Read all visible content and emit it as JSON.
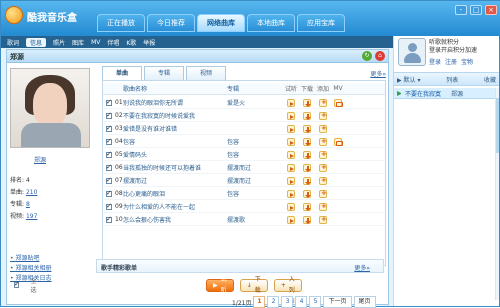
{
  "app": {
    "title": "酷我音乐盒",
    "controls": [
      "-",
      "□",
      "×"
    ]
  },
  "main_tabs": [
    {
      "label": "正在播放",
      "active": false
    },
    {
      "label": "今日推荐",
      "active": false
    },
    {
      "label": "网络曲库",
      "active": true
    },
    {
      "label": "本地曲库",
      "active": false
    },
    {
      "label": "应用宝库",
      "active": false
    }
  ],
  "subnav": [
    "歌词",
    "信息",
    "照片",
    "图库",
    "MV",
    "伴唱",
    "K歌",
    "举报"
  ],
  "artist": {
    "name": "郑源",
    "caption": "郑源",
    "meta": [
      {
        "label": "排名:",
        "value": "4"
      },
      {
        "label": "单曲:",
        "value": "210"
      },
      {
        "label": "专辑:",
        "value": "8"
      },
      {
        "label": "视频:",
        "value": "197"
      }
    ],
    "links": [
      "郑源贴吧",
      "郑源相关相册",
      "郑源相关日志"
    ]
  },
  "song_tabs": [
    {
      "label": "单曲",
      "active": true
    },
    {
      "label": "专辑",
      "active": false
    },
    {
      "label": "视频",
      "active": false
    }
  ],
  "more": "更多»",
  "table": {
    "headers": {
      "name": "歌曲名称",
      "album": "专辑",
      "listen": "试听",
      "download": "下载",
      "add": "添加",
      "mv": "MV"
    },
    "rows": [
      {
        "num": "01",
        "name": "别说我的眼泪你无所谓",
        "album": "爱是火"
      },
      {
        "num": "02",
        "name": "不要在我寂寞的时候说爱我",
        "album": ""
      },
      {
        "num": "03",
        "name": "爱错是没有谁对谁错",
        "album": ""
      },
      {
        "num": "04",
        "name": "包容",
        "album": "包容"
      },
      {
        "num": "05",
        "name": "爱情码头",
        "album": "包容"
      },
      {
        "num": "06",
        "name": "当我孤独的时候还可以抱着谁",
        "album": "摆渡而过"
      },
      {
        "num": "07",
        "name": "摆渡而过",
        "album": "摆渡而过"
      },
      {
        "num": "08",
        "name": "比心更痛的眼泪",
        "album": "包容"
      },
      {
        "num": "09",
        "name": "为什么相爱的人不能在一起",
        "album": ""
      },
      {
        "num": "10",
        "name": "怎么会狠心伤害我",
        "album": "摆渡歌"
      }
    ]
  },
  "bottom": {
    "select_all": "全选",
    "listen": "试听",
    "download": "下载",
    "add_to_list": "加入列表"
  },
  "pager": {
    "summary": "1/21页",
    "pages": [
      "1",
      "2",
      "3",
      "4",
      "5"
    ],
    "current": "1",
    "next": "下一页",
    "last": "尾页"
  },
  "recommendation": {
    "title": "歌手精彩歌单",
    "more": "更多»"
  },
  "right": {
    "user_text_1": "听歌就积分",
    "user_text_2": "登录开启积分加速",
    "links": [
      "登录",
      "注册",
      "宝物"
    ],
    "nav": [
      "默认",
      "列表",
      "收藏"
    ],
    "playlist": [
      {
        "song": "不要在我寂寞",
        "artist": "郑源"
      }
    ]
  }
}
